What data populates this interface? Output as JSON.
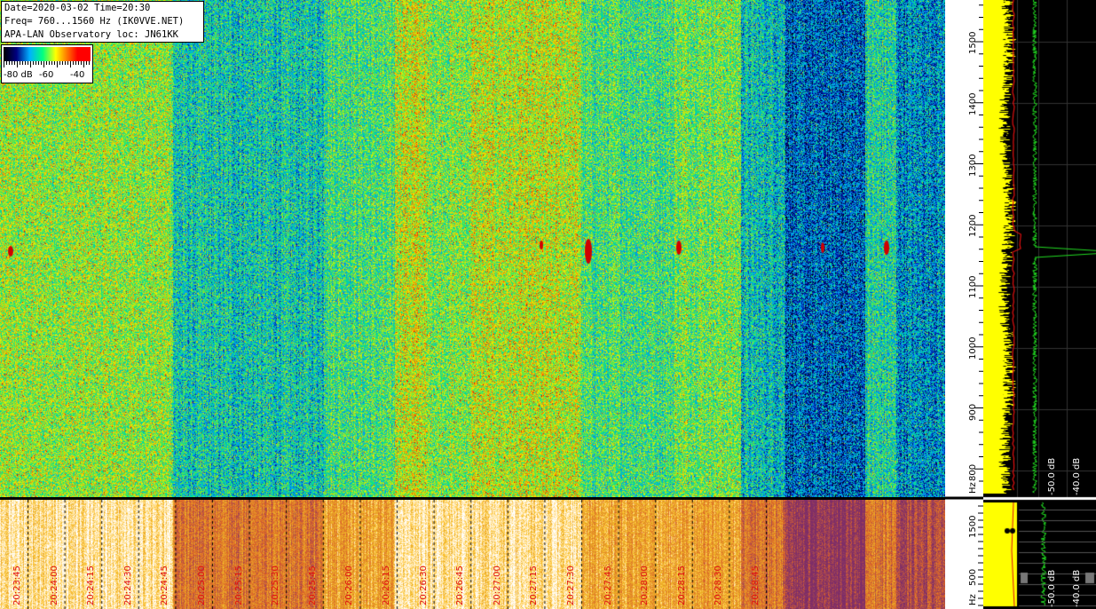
{
  "info": {
    "line1": "Date=2020-03-02 Time=20:30",
    "line2": "Freq= 760...1560 Hz (IK0VVE.NET)",
    "line3": "APA-LAN Observatory loc: JN61KK"
  },
  "color_scale": {
    "min_label": "-80 dB",
    "mid_label": "-60",
    "max_label": "-40"
  },
  "freq_axis": {
    "unit": "Hz",
    "ticks": [
      "1500",
      "1400",
      "1300",
      "1200",
      "1100",
      "1000",
      "900",
      "800"
    ],
    "lower_ticks": [
      "1500",
      "500"
    ]
  },
  "db_labels": {
    "upper": [
      "-50.0 dB",
      "-40.0 dB"
    ],
    "lower": [
      "-50.0 dB",
      "-40.0 dB"
    ]
  },
  "time_labels": [
    "20:23:45",
    "20:24:00",
    "20:24:15",
    "20:24:30",
    "20:24:45",
    "20:25:00",
    "20:25:15",
    "20:25:30",
    "20:25:45",
    "20:26:00",
    "20:26:15",
    "20:26:30",
    "20:26:45",
    "20:27:00",
    "20:27:15",
    "20:27:30",
    "20:27:45",
    "20:28:00",
    "20:28:15",
    "20:28:30",
    "20:28:45"
  ],
  "colors": {
    "spectrum_avg": "#ffff00",
    "spectrum_peak": "#22dd22",
    "marker": "#e01010"
  }
}
